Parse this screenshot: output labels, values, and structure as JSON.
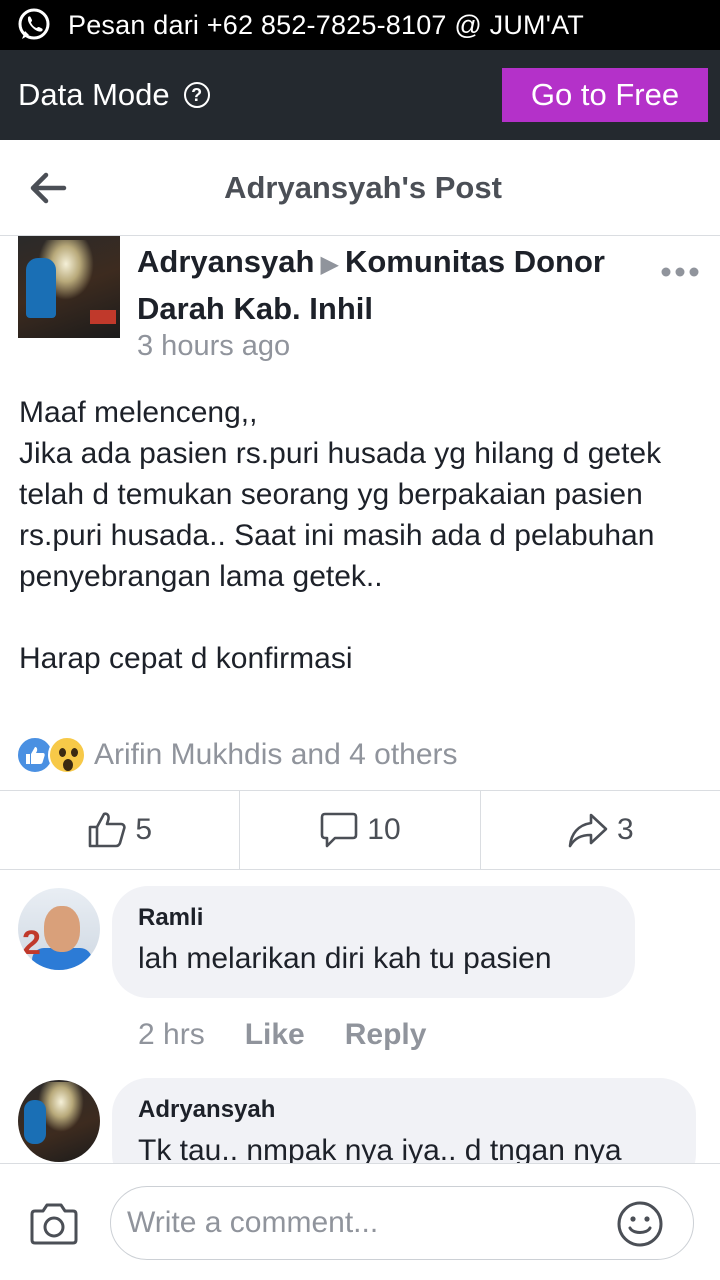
{
  "notification": {
    "text": "Pesan dari +62 852-7825-8107 @ JUM'AT",
    "icon": "whatsapp-icon"
  },
  "data_mode": {
    "label": "Data Mode",
    "help_icon": "?",
    "go_free_label": "Go to Free",
    "accent": "#b431c9"
  },
  "header": {
    "title": "Adryansyah's Post",
    "back_icon": "back-arrow-icon"
  },
  "post": {
    "author": "Adryansyah",
    "group": "Komunitas Donor Darah Kab. Inhil",
    "time": "3 hours ago",
    "body": "Maaf melenceng,,\nJika ada pasien rs.puri husada yg hilang d getek telah d temukan seorang yg berpakaian pasien rs.puri husada.. Saat ini masih ada d pelabuhan penyebrangan lama getek..\n\nHarap cepat d konfirmasi",
    "reactions_text": "Arifin Mukhdis and 4 others",
    "likes": "5",
    "comments": "10",
    "shares": "3"
  },
  "comments": [
    {
      "name": "Ramli",
      "text": "lah melarikan diri kah tu pasien",
      "time": "2 hrs",
      "like_label": "Like",
      "reply_label": "Reply"
    },
    {
      "name": "Adryansyah",
      "text": "Tk tau.. nmpak nya iya.. d tngan nya"
    }
  ],
  "composer": {
    "placeholder": "Write a comment..."
  }
}
